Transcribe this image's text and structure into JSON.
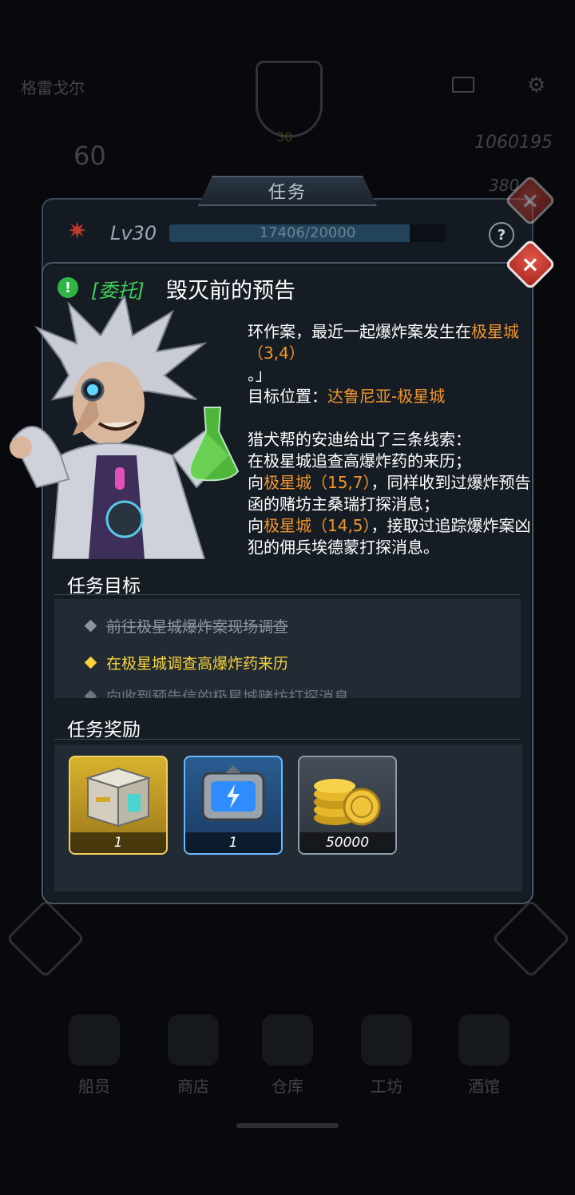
{
  "background": {
    "player_name": "格雷戈尔",
    "level": "30",
    "power": "60",
    "gold": "1060195",
    "gems": "380",
    "nav": [
      "船员",
      "商店",
      "仓库",
      "工坊",
      "酒馆"
    ]
  },
  "task_panel": {
    "tab_title": "任务",
    "level_label": "Lv30",
    "xp_text": "17406/20000",
    "xp_fraction": 0.8703,
    "help_label": "?"
  },
  "quest": {
    "alert_icon": "!",
    "type_label": "[委托]",
    "title": "毁灭前的预告",
    "story": {
      "line1_plain": "环作案，最近一起爆炸案发生在",
      "line1_hl": "极星城（3,4）",
      "line2": "。」",
      "target_label": "目标位置：",
      "target_value": "达鲁尼亚-极星城",
      "clue_intro": "猎犬帮的安迪给出了三条线索：",
      "clue1": "在极星城追查高爆炸药的来历；",
      "clue2_pre": "向",
      "clue2_hl": "极星城（15,7）",
      "clue2_post": "，同样收到过爆炸预告函的赌坊主桑瑞打探消息；",
      "clue3_pre": "向",
      "clue3_hl": "极星城（14,5）",
      "clue3_post": "，接取过追踪爆炸案凶犯的佣兵埃德蒙打探消息。"
    },
    "objectives_title": "任务目标",
    "objectives": [
      "前往极星城爆炸案现场调查",
      "在极星城调查高爆炸药来历",
      "向收到预告信的极星城赌坊打探消息"
    ],
    "rewards_title": "任务奖励",
    "rewards": [
      {
        "icon": "supply-crate-icon",
        "qty": "1"
      },
      {
        "icon": "energy-battery-icon",
        "qty": "1"
      },
      {
        "icon": "gold-coins-icon",
        "qty": "50000"
      }
    ]
  },
  "colors": {
    "highlight": "#f0962c",
    "active_objective": "#f6d23c",
    "quest_type": "#3ecf5a",
    "close_red": "#c5342a"
  }
}
